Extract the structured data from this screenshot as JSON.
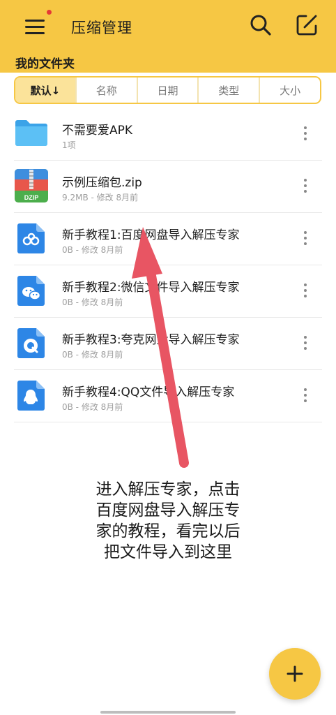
{
  "header": {
    "title": "压缩管理",
    "folder_label": "我的文件夹",
    "menu_icon": "hamburger-menu-icon",
    "search_icon": "search-icon",
    "edit_icon": "edit-icon",
    "background_color": "#f6c744",
    "badge_color": "#e53935"
  },
  "sort_tabs": [
    {
      "label": "默认↓",
      "active": true
    },
    {
      "label": "名称",
      "active": false
    },
    {
      "label": "日期",
      "active": false
    },
    {
      "label": "类型",
      "active": false
    },
    {
      "label": "大小",
      "active": false
    }
  ],
  "files": [
    {
      "name": "不需要爱APK",
      "meta": "1项",
      "icon": "folder-icon"
    },
    {
      "name": "示例压缩包.zip",
      "meta": "9.2MB - 修改 8月前",
      "icon": "zip-archive-icon",
      "icon_text": "DZIP"
    },
    {
      "name": "新手教程1:百度网盘导入解压专家",
      "meta": "0B - 修改 8月前",
      "icon": "baidu-netdisk-icon"
    },
    {
      "name": "新手教程2:微信文件导入解压专家",
      "meta": "0B - 修改 8月前",
      "icon": "wechat-icon"
    },
    {
      "name": "新手教程3:夸克网盘导入解压专家",
      "meta": "0B - 修改 8月前",
      "icon": "quark-icon"
    },
    {
      "name": "新手教程4:QQ文件导入解压专家",
      "meta": "0B - 修改 8月前",
      "icon": "qq-icon"
    }
  ],
  "annotation": {
    "lines": [
      "进入解压专家，点击",
      "百度网盘导入解压专",
      "家的教程，看完以后",
      "把文件导入到这里"
    ],
    "arrow_color": "#e85563"
  },
  "fab": {
    "icon": "plus-icon",
    "color": "#f6c744"
  }
}
